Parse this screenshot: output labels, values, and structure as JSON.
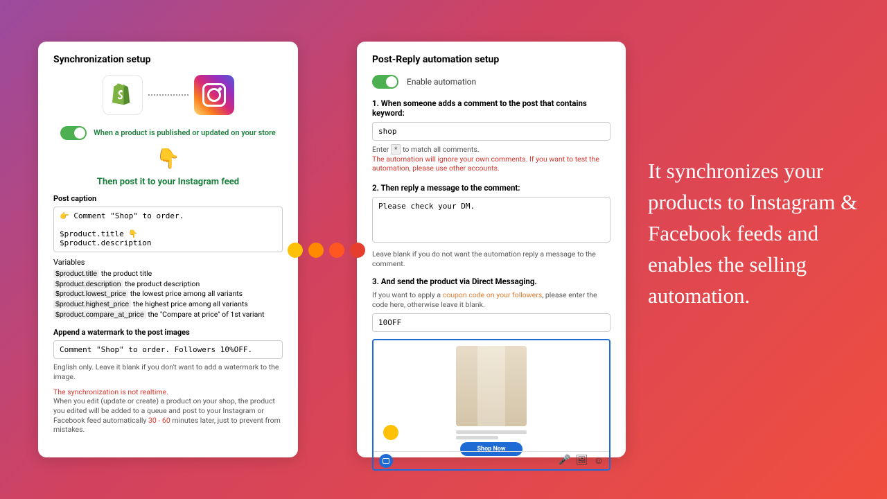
{
  "leftCard": {
    "title": "Synchronization setup",
    "toggleLabel": "When a product is published or updated on your store",
    "postLabel": "Then post it to your Instagram feed",
    "captionLabel": "Post caption",
    "captionValue": "👉 Comment \"Shop\" to order.\n\n$product.title 👇\n$product.description",
    "varsTitle": "Variables",
    "vars": [
      {
        "code": "$product.title",
        "desc": " the product title"
      },
      {
        "code": "$product.description",
        "desc": " the product description"
      },
      {
        "code": "$product.lowest_price",
        "desc": " the lowest price among all variants"
      },
      {
        "code": "$product.highest_price",
        "desc": " the highest price among all variants"
      },
      {
        "code": "$product.compare_at_price",
        "desc": " the \"Compare at price\" of 1st variant"
      }
    ],
    "watermarkLabel": "Append a watermark to the post images",
    "watermarkValue": "Comment \"Shop\" to order. Followers 10%OFF.",
    "watermarkHelp": "English only. Leave it blank if you don't want to add a watermark to the image.",
    "realtimeWarn": "The synchronization is not realtime.",
    "realtimeText1": "When you edit (update or create) a product on your shop, the product you edited will be added to a queue and post to your Instagram or Facebook feed automatically ",
    "realtimeRange": "30 - 60",
    "realtimeText2": " minutes later, just to prevent from mistakes."
  },
  "rightCard": {
    "title": "Post-Reply automation setup",
    "enableLabel": "Enable automation",
    "step1": "1. When someone adds a comment to the post that contains keyword:",
    "keywordValue": "shop",
    "matchHelp1": "Enter ",
    "matchStar": "*",
    "matchHelp2": " to match all comments.",
    "ownWarn": "The automation will ignore your own comments. If you want to test the automation, please use other accounts.",
    "step2": "2. Then reply a message to the comment:",
    "replyValue": "Please check your DM.",
    "replyHelp": "Leave blank if you do not want the automation reply a message to the comment.",
    "step3": "3. And send the product via Direct Messaging.",
    "couponHelp1": "If you want to apply a ",
    "couponLink": "coupon code on your followers",
    "couponHelp2": ", please enter the code here, otherwise leave it blank.",
    "couponValue": "10OFF",
    "shopBtn": "Shop Now"
  },
  "headline": "It synchronizes your products to Instagram & Facebook feeds and enables the selling automation."
}
